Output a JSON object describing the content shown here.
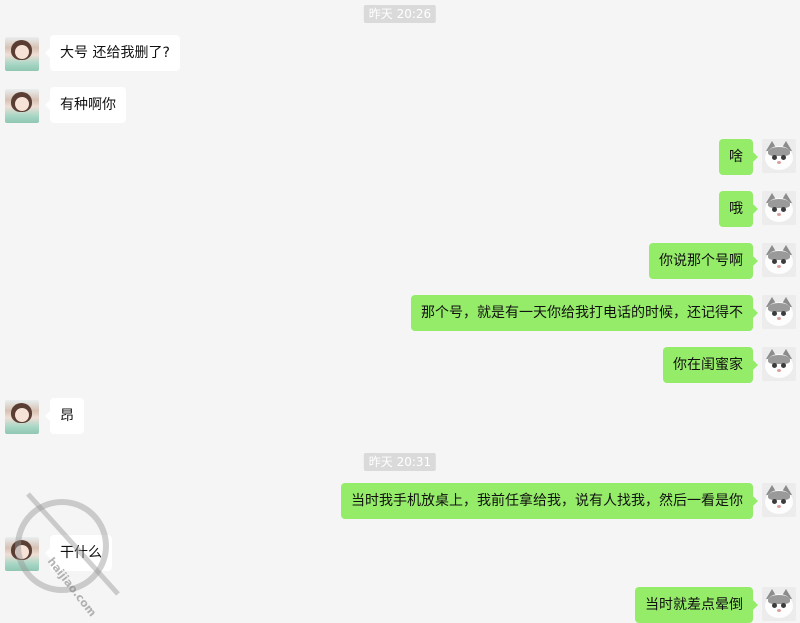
{
  "timestamps": [
    "昨天 20:26",
    "昨天 20:31"
  ],
  "messages": [
    {
      "sender": "other",
      "avatar": "girl-avatar",
      "text": "大号 还给我删了?"
    },
    {
      "sender": "other",
      "avatar": "girl-avatar",
      "text": "有种啊你"
    },
    {
      "sender": "me",
      "avatar": "cat-avatar",
      "text": "啥"
    },
    {
      "sender": "me",
      "avatar": "cat-avatar",
      "text": "哦"
    },
    {
      "sender": "me",
      "avatar": "cat-avatar",
      "text": "你说那个号啊"
    },
    {
      "sender": "me",
      "avatar": "cat-avatar",
      "text": "那个号，就是有一天你给我打电话的时候，还记得不"
    },
    {
      "sender": "me",
      "avatar": "cat-avatar",
      "text": "你在闺蜜家"
    },
    {
      "sender": "other",
      "avatar": "girl-avatar",
      "text": "昂"
    },
    {
      "sender": "me",
      "avatar": "cat-avatar",
      "text": "当时我手机放桌上，我前任拿给我，说有人找我，然后一看是你"
    },
    {
      "sender": "other",
      "avatar": "girl-avatar",
      "text": "干什么"
    },
    {
      "sender": "me",
      "avatar": "cat-avatar",
      "text": "当时就差点晕倒"
    }
  ],
  "colors": {
    "background": "#f5f5f5",
    "my_bubble": "#95ec69",
    "other_bubble": "#ffffff",
    "timestamp_bg": "#dadada"
  },
  "watermark": "haijiao.com"
}
